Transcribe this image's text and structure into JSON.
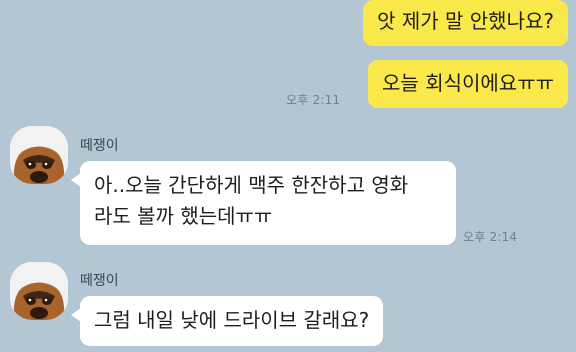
{
  "messages": {
    "m1": {
      "text": "앗 제가 말 안했나요?"
    },
    "m2": {
      "text": "오늘 회식이에요ㅠㅠ",
      "time": "오후 2:11"
    },
    "m3": {
      "sender": "떼쟁이",
      "line1": "아..오늘 간단하게 맥주 한잔하고 영화",
      "line2": "라도 볼까 했는데ㅠㅠ",
      "time": "오후 2:14"
    },
    "m4": {
      "sender": "떼쟁이",
      "text": "그럼 내일 낮에 드라이브 갈래요?"
    }
  },
  "avatar_icon": "dog-face-icon",
  "colors": {
    "background": "#b3c6d4",
    "my_bubble": "#fbe94b",
    "their_bubble": "#ffffff"
  }
}
